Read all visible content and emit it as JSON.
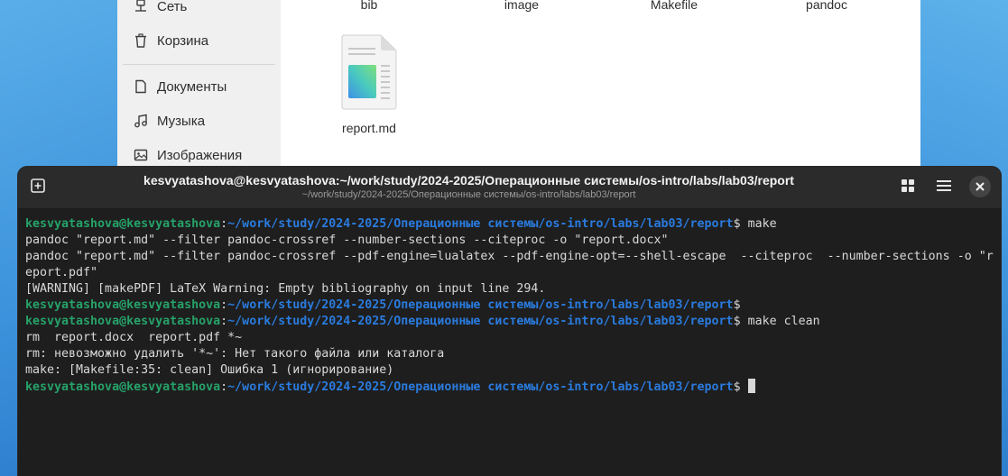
{
  "file_manager": {
    "sidebar": {
      "items": [
        {
          "label": "Сеть",
          "icon": "network-icon"
        },
        {
          "label": "Корзина",
          "icon": "trash-icon"
        },
        {
          "label": "Документы",
          "icon": "document-icon"
        },
        {
          "label": "Музыка",
          "icon": "music-icon"
        },
        {
          "label": "Изображения",
          "icon": "image-icon"
        }
      ]
    },
    "files": [
      {
        "name": "bib"
      },
      {
        "name": "image"
      },
      {
        "name": "Makefile"
      },
      {
        "name": "pandoc"
      },
      {
        "name": "report.md",
        "icon": "markdown-file-icon"
      }
    ]
  },
  "terminal": {
    "title": "kesvyatashova@kesvyatashova:~/work/study/2024-2025/Операционные системы/os-intro/labs/lab03/report",
    "subtitle": "~/work/study/2024-2025/Операционные системы/os-intro/labs/lab03/report",
    "prompt_user": "kesvyatashova@kesvyatashova",
    "prompt_path": "~/work/study/2024-2025/Операционные системы/os-intro/labs/lab03/report",
    "lines": [
      {
        "type": "prompt",
        "cmd": "$ make"
      },
      {
        "type": "out",
        "text": "pandoc \"report.md\" --filter pandoc-crossref --number-sections --citeproc -o \"report.docx\""
      },
      {
        "type": "out",
        "text": "pandoc \"report.md\" --filter pandoc-crossref --pdf-engine=lualatex --pdf-engine-opt=--shell-escape  --citeproc  --number-sections -o \"r"
      },
      {
        "type": "out",
        "text": "eport.pdf\""
      },
      {
        "type": "out",
        "text": "[WARNING] [makePDF] LaTeX Warning: Empty bibliography on input line 294."
      },
      {
        "type": "prompt",
        "cmd": "$"
      },
      {
        "type": "prompt",
        "cmd": "$ make clean"
      },
      {
        "type": "out",
        "text": "rm  report.docx  report.pdf *~"
      },
      {
        "type": "out",
        "text": "rm: невозможно удалить '*~': Нет такого файла или каталога"
      },
      {
        "type": "out",
        "text": "make: [Makefile:35: clean] Ошибка 1 (игнорирование)"
      },
      {
        "type": "prompt",
        "cmd": "$ ",
        "cursor": true
      }
    ]
  },
  "colors": {
    "prompt_user": "#26a269",
    "prompt_path": "#2a7bde",
    "terminal_bg": "#1e1e1e",
    "header_bg": "#2b2b2b"
  }
}
